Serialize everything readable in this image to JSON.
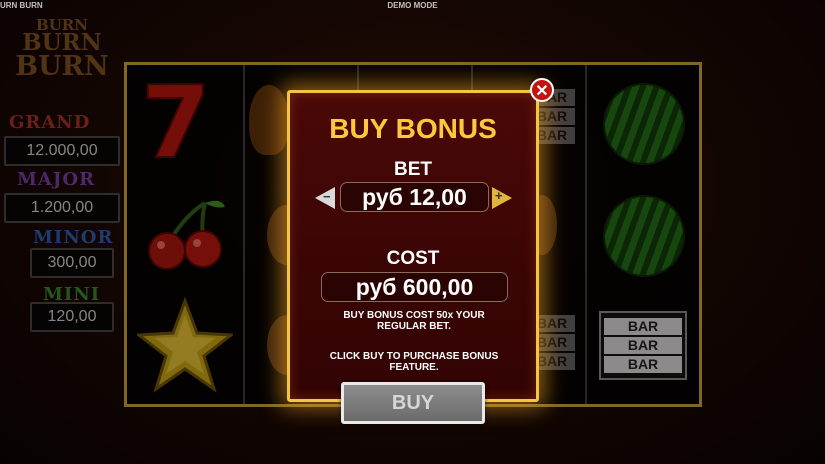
{
  "header": {
    "game_title": "URN BURN",
    "mode": "DEMO MODE"
  },
  "logo": {
    "lines": [
      "BURN",
      "BURN",
      "BURN"
    ]
  },
  "jackpots": [
    {
      "label": "GRAND",
      "value": "12.000,00",
      "color": "#c23a2e"
    },
    {
      "label": "MAJOR",
      "value": "1.200,00",
      "color": "#8a4bc4"
    },
    {
      "label": "MINOR",
      "value": "300,00",
      "color": "#2f6fd1"
    },
    {
      "label": "MINI",
      "value": "120,00",
      "color": "#3aa636"
    }
  ],
  "reels": {
    "symbols": [
      "seven",
      "cherry",
      "star",
      "watermelon",
      "bar",
      "bar"
    ],
    "bar_label": "BAR"
  },
  "modal": {
    "title": "BUY BONUS",
    "bet_label": "BET",
    "bet_value": "руб 12,00",
    "decrease_glyph": "−",
    "increase_glyph": "+",
    "cost_label": "COST",
    "cost_value": "руб 600,00",
    "info_1": "BUY BONUS COST 50x YOUR REGULAR BET.",
    "info_2": "CLICK BUY TO PURCHASE BONUS FEATURE.",
    "buy_label": "BUY",
    "close_glyph": "✕"
  },
  "colors": {
    "accent": "#ffc83a",
    "modal_border": "#f4c543",
    "close": "#c4140e"
  }
}
